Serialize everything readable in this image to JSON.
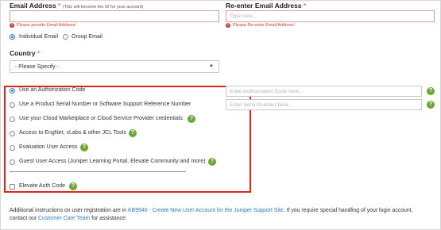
{
  "email": {
    "label": "Email Address",
    "required_mark": "*",
    "hint": "(This will become the ID for your account)",
    "value": "",
    "error": "Please provide Email Address!"
  },
  "reenter": {
    "label": "Re-enter Email Address",
    "required_mark": "*",
    "placeholder": "Type here...",
    "error": "Please Re-enter Email Address!"
  },
  "email_type": {
    "individual": "Individual Email",
    "group": "Group Email"
  },
  "country": {
    "label": "Country",
    "required_mark": "*",
    "value": "- Please Specify -"
  },
  "options": [
    "Use an Authorization Code",
    "Use a Product Serial Number or Software Support Reference Number",
    "Use your Cloud Marketplace or Cloud Service Provider credentials",
    "Access to EngNet, vLabs & other JCL Tools",
    "Evaluation User Access",
    "Guest User Access (Juniper Learning Portal, Elevate Community and more)"
  ],
  "elevate": {
    "label": "Elevate Auth Code"
  },
  "auth_code": {
    "placeholder": "Enter Authorization Code here..."
  },
  "serial": {
    "placeholder": "Enter Serial Number here..."
  },
  "footer": {
    "text1": "Additional instructions on user registration are in",
    "kb_link": "KB9946 - Create New User Account for the Juniper Support Site",
    "text2": ". If you require special handling of your login account,",
    "text3": "contact our",
    "care_link": "Customer Care Team",
    "text4": "for assistance."
  },
  "icons": {
    "help": "help-icon",
    "error": "error-icon",
    "dropdown": "chevron-down-icon"
  },
  "colors": {
    "highlight_box": "#e0251d",
    "help_icon": "#6aa832",
    "link": "#2e7dc4",
    "error": "#d03b3b"
  }
}
